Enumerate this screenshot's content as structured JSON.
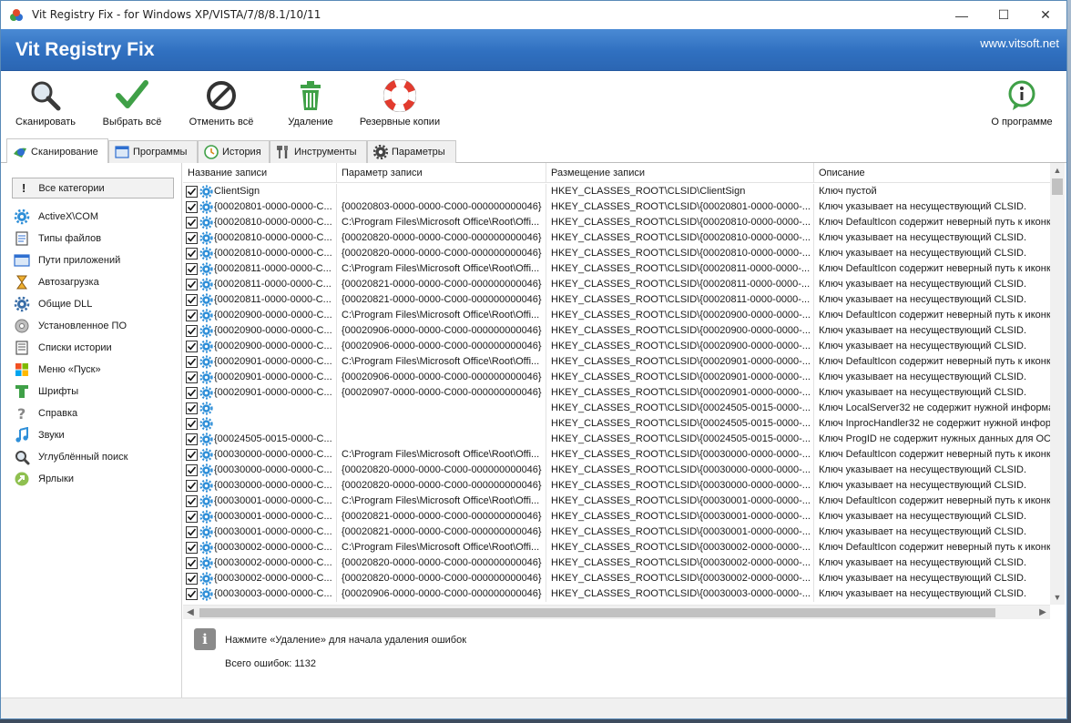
{
  "window": {
    "title": "Vit Registry Fix - for Windows XP/VISTA/7/8/8.1/10/11",
    "minimize": "—",
    "maximize": "☐",
    "close": "✕"
  },
  "header": {
    "app_title": "Vit Registry Fix",
    "website": "www.vitsoft.net"
  },
  "toolbar": {
    "scan": "Сканировать",
    "select_all": "Выбрать всё",
    "deselect_all": "Отменить всё",
    "delete": "Удаление",
    "backups": "Резервные копии",
    "about": "О программе"
  },
  "tabs": [
    {
      "label": "Сканирование",
      "active": true
    },
    {
      "label": "Программы",
      "active": false
    },
    {
      "label": "История",
      "active": false
    },
    {
      "label": "Инструменты",
      "active": false
    },
    {
      "label": "Параметры",
      "active": false
    }
  ],
  "sidebar": {
    "all_label": "Все категории",
    "all_mark": "!",
    "items": [
      {
        "label": "ActiveX\\COM",
        "icon": "gear-icon"
      },
      {
        "label": "Типы файлов",
        "icon": "file-types-icon"
      },
      {
        "label": "Пути приложений",
        "icon": "app-paths-icon"
      },
      {
        "label": "Автозагрузка",
        "icon": "hourglass-icon"
      },
      {
        "label": "Общие DLL",
        "icon": "dll-gear-icon"
      },
      {
        "label": "Установленное ПО",
        "icon": "disc-icon"
      },
      {
        "label": "Списки истории",
        "icon": "history-list-icon"
      },
      {
        "label": "Меню «Пуск»",
        "icon": "windows-logo-icon"
      },
      {
        "label": "Шрифты",
        "icon": "font-icon"
      },
      {
        "label": "Справка",
        "icon": "help-icon"
      },
      {
        "label": "Звуки",
        "icon": "music-note-icon"
      },
      {
        "label": "Углублённый поиск",
        "icon": "magnifier-icon"
      },
      {
        "label": "Ярлыки",
        "icon": "shortcut-icon"
      }
    ]
  },
  "grid": {
    "columns": [
      "Название записи",
      "Параметр записи",
      "Размещение записи",
      "Описание"
    ],
    "rows": [
      {
        "name": "ClientSign",
        "param": "",
        "location": "HKEY_CLASSES_ROOT\\CLSID\\ClientSign",
        "desc": "Ключ пустой"
      },
      {
        "name": "{00020801-0000-0000-C...",
        "param": "{00020803-0000-0000-C000-000000000046}",
        "location": "HKEY_CLASSES_ROOT\\CLSID\\{00020801-0000-0000-...",
        "desc": "Ключ указывает на несуществующий CLSID."
      },
      {
        "name": "{00020810-0000-0000-C...",
        "param": "C:\\Program Files\\Microsoft Office\\Root\\Offi...",
        "location": "HKEY_CLASSES_ROOT\\CLSID\\{00020810-0000-0000-...",
        "desc": "Ключ DefaultIcon содержит неверный путь к иконке"
      },
      {
        "name": "{00020810-0000-0000-C...",
        "param": "{00020820-0000-0000-C000-000000000046}",
        "location": "HKEY_CLASSES_ROOT\\CLSID\\{00020810-0000-0000-...",
        "desc": "Ключ указывает на несуществующий CLSID."
      },
      {
        "name": "{00020810-0000-0000-C...",
        "param": "{00020820-0000-0000-C000-000000000046}",
        "location": "HKEY_CLASSES_ROOT\\CLSID\\{00020810-0000-0000-...",
        "desc": "Ключ указывает на несуществующий CLSID."
      },
      {
        "name": "{00020811-0000-0000-C...",
        "param": "C:\\Program Files\\Microsoft Office\\Root\\Offi...",
        "location": "HKEY_CLASSES_ROOT\\CLSID\\{00020811-0000-0000-...",
        "desc": "Ключ DefaultIcon содержит неверный путь к иконке"
      },
      {
        "name": "{00020811-0000-0000-C...",
        "param": "{00020821-0000-0000-C000-000000000046}",
        "location": "HKEY_CLASSES_ROOT\\CLSID\\{00020811-0000-0000-...",
        "desc": "Ключ указывает на несуществующий CLSID."
      },
      {
        "name": "{00020811-0000-0000-C...",
        "param": "{00020821-0000-0000-C000-000000000046}",
        "location": "HKEY_CLASSES_ROOT\\CLSID\\{00020811-0000-0000-...",
        "desc": "Ключ указывает на несуществующий CLSID."
      },
      {
        "name": "{00020900-0000-0000-C...",
        "param": "C:\\Program Files\\Microsoft Office\\Root\\Offi...",
        "location": "HKEY_CLASSES_ROOT\\CLSID\\{00020900-0000-0000-...",
        "desc": "Ключ DefaultIcon содержит неверный путь к иконке"
      },
      {
        "name": "{00020900-0000-0000-C...",
        "param": "{00020906-0000-0000-C000-000000000046}",
        "location": "HKEY_CLASSES_ROOT\\CLSID\\{00020900-0000-0000-...",
        "desc": "Ключ указывает на несуществующий CLSID."
      },
      {
        "name": "{00020900-0000-0000-C...",
        "param": "{00020906-0000-0000-C000-000000000046}",
        "location": "HKEY_CLASSES_ROOT\\CLSID\\{00020900-0000-0000-...",
        "desc": "Ключ указывает на несуществующий CLSID."
      },
      {
        "name": "{00020901-0000-0000-C...",
        "param": "C:\\Program Files\\Microsoft Office\\Root\\Offi...",
        "location": "HKEY_CLASSES_ROOT\\CLSID\\{00020901-0000-0000-...",
        "desc": "Ключ DefaultIcon содержит неверный путь к иконке"
      },
      {
        "name": "{00020901-0000-0000-C...",
        "param": "{00020906-0000-0000-C000-000000000046}",
        "location": "HKEY_CLASSES_ROOT\\CLSID\\{00020901-0000-0000-...",
        "desc": "Ключ указывает на несуществующий CLSID."
      },
      {
        "name": "{00020901-0000-0000-C...",
        "param": "{00020907-0000-0000-C000-000000000046}",
        "location": "HKEY_CLASSES_ROOT\\CLSID\\{00020901-0000-0000-...",
        "desc": "Ключ указывает на несуществующий CLSID."
      },
      {
        "name": "",
        "param": "",
        "location": "HKEY_CLASSES_ROOT\\CLSID\\{00024505-0015-0000-...",
        "desc": "Ключ LocalServer32 не содержит нужной информации"
      },
      {
        "name": "",
        "param": "",
        "location": "HKEY_CLASSES_ROOT\\CLSID\\{00024505-0015-0000-...",
        "desc": "Ключ InprocHandler32 не содержит нужной информации"
      },
      {
        "name": "{00024505-0015-0000-C...",
        "param": "",
        "location": "HKEY_CLASSES_ROOT\\CLSID\\{00024505-0015-0000-...",
        "desc": "Ключ ProgID не содержит нужных данных для ОС."
      },
      {
        "name": "{00030000-0000-0000-C...",
        "param": "C:\\Program Files\\Microsoft Office\\Root\\Offi...",
        "location": "HKEY_CLASSES_ROOT\\CLSID\\{00030000-0000-0000-...",
        "desc": "Ключ DefaultIcon содержит неверный путь к иконке"
      },
      {
        "name": "{00030000-0000-0000-C...",
        "param": "{00020820-0000-0000-C000-000000000046}",
        "location": "HKEY_CLASSES_ROOT\\CLSID\\{00030000-0000-0000-...",
        "desc": "Ключ указывает на несуществующий CLSID."
      },
      {
        "name": "{00030000-0000-0000-C...",
        "param": "{00020820-0000-0000-C000-000000000046}",
        "location": "HKEY_CLASSES_ROOT\\CLSID\\{00030000-0000-0000-...",
        "desc": "Ключ указывает на несуществующий CLSID."
      },
      {
        "name": "{00030001-0000-0000-C...",
        "param": "C:\\Program Files\\Microsoft Office\\Root\\Offi...",
        "location": "HKEY_CLASSES_ROOT\\CLSID\\{00030001-0000-0000-...",
        "desc": "Ключ DefaultIcon содержит неверный путь к иконке"
      },
      {
        "name": "{00030001-0000-0000-C...",
        "param": "{00020821-0000-0000-C000-000000000046}",
        "location": "HKEY_CLASSES_ROOT\\CLSID\\{00030001-0000-0000-...",
        "desc": "Ключ указывает на несуществующий CLSID."
      },
      {
        "name": "{00030001-0000-0000-C...",
        "param": "{00020821-0000-0000-C000-000000000046}",
        "location": "HKEY_CLASSES_ROOT\\CLSID\\{00030001-0000-0000-...",
        "desc": "Ключ указывает на несуществующий CLSID."
      },
      {
        "name": "{00030002-0000-0000-C...",
        "param": "C:\\Program Files\\Microsoft Office\\Root\\Offi...",
        "location": "HKEY_CLASSES_ROOT\\CLSID\\{00030002-0000-0000-...",
        "desc": "Ключ DefaultIcon содержит неверный путь к иконке"
      },
      {
        "name": "{00030002-0000-0000-C...",
        "param": "{00020820-0000-0000-C000-000000000046}",
        "location": "HKEY_CLASSES_ROOT\\CLSID\\{00030002-0000-0000-...",
        "desc": "Ключ указывает на несуществующий CLSID."
      },
      {
        "name": "{00030002-0000-0000-C...",
        "param": "{00020820-0000-0000-C000-000000000046}",
        "location": "HKEY_CLASSES_ROOT\\CLSID\\{00030002-0000-0000-...",
        "desc": "Ключ указывает на несуществующий CLSID."
      },
      {
        "name": "{00030003-0000-0000-C...",
        "param": "{00020906-0000-0000-C000-000000000046}",
        "location": "HKEY_CLASSES_ROOT\\CLSID\\{00030003-0000-0000-...",
        "desc": "Ключ указывает на несуществующий CLSID."
      }
    ]
  },
  "status": {
    "info_mark": "i",
    "hint": "Нажмите «Удаление» для начала удаления ошибок",
    "total": "Всего ошибок: 1132"
  },
  "colors": {
    "header_blue": "#3070c0",
    "accent_green": "#3fa047",
    "gear_blue": "#2f8fd8"
  }
}
